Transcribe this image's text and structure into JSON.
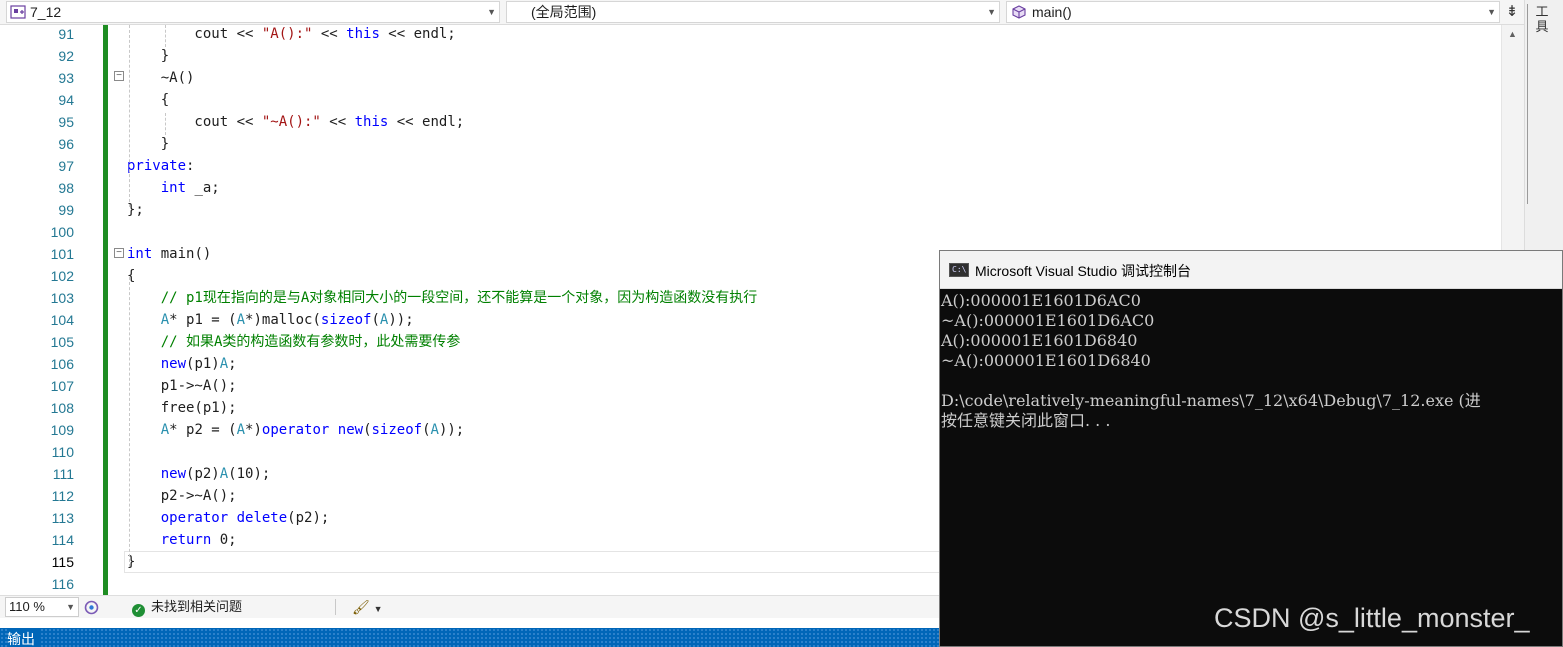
{
  "nav": {
    "project": "7_12",
    "scope": "(全局范围)",
    "function": "main()"
  },
  "side": {
    "toolbox_tab": "工具"
  },
  "editor": {
    "lines": [
      {
        "num": "91",
        "tokens": [
          [
            "",
            "        cout << "
          ],
          [
            "str",
            "\"A():\""
          ],
          [
            "",
            " << "
          ],
          [
            "kw",
            "this"
          ],
          [
            "",
            " << endl;"
          ]
        ]
      },
      {
        "num": "92",
        "tokens": [
          [
            "",
            "    }"
          ]
        ]
      },
      {
        "num": "93",
        "tokens": [
          [
            "",
            "    ~A()"
          ]
        ]
      },
      {
        "num": "94",
        "tokens": [
          [
            "",
            "    {"
          ]
        ]
      },
      {
        "num": "95",
        "tokens": [
          [
            "",
            "        cout << "
          ],
          [
            "str",
            "\"~A():\""
          ],
          [
            "",
            " << "
          ],
          [
            "kw",
            "this"
          ],
          [
            "",
            " << endl;"
          ]
        ]
      },
      {
        "num": "96",
        "tokens": [
          [
            "",
            "    }"
          ]
        ]
      },
      {
        "num": "97",
        "tokens": [
          [
            "kw",
            "private"
          ],
          [
            "",
            ":"
          ]
        ]
      },
      {
        "num": "98",
        "tokens": [
          [
            "",
            "    "
          ],
          [
            "kw",
            "int"
          ],
          [
            "",
            " _a;"
          ]
        ]
      },
      {
        "num": "99",
        "tokens": [
          [
            "",
            "};"
          ]
        ]
      },
      {
        "num": "100",
        "tokens": []
      },
      {
        "num": "101",
        "tokens": [
          [
            "kw",
            "int"
          ],
          [
            "",
            " main()"
          ]
        ]
      },
      {
        "num": "102",
        "tokens": [
          [
            "",
            "{"
          ]
        ]
      },
      {
        "num": "103",
        "tokens": [
          [
            "cm",
            "    // p1现在指向的是与A对象相同大小的一段空间，还不能算是一个对象，因为构造函数没有执行"
          ]
        ]
      },
      {
        "num": "104",
        "tokens": [
          [
            "",
            "    "
          ],
          [
            "ty",
            "A"
          ],
          [
            "",
            "* p1 = ("
          ],
          [
            "ty",
            "A"
          ],
          [
            "",
            "*)malloc("
          ],
          [
            "kw",
            "sizeof"
          ],
          [
            "",
            "("
          ],
          [
            "ty",
            "A"
          ],
          [
            "",
            "));"
          ]
        ]
      },
      {
        "num": "105",
        "tokens": [
          [
            "cm",
            "    // 如果A类的构造函数有参数时，此处需要传参"
          ]
        ]
      },
      {
        "num": "106",
        "tokens": [
          [
            "",
            "    "
          ],
          [
            "kw",
            "new"
          ],
          [
            "",
            "(p1)"
          ],
          [
            "ty",
            "A"
          ],
          [
            "",
            ";"
          ]
        ]
      },
      {
        "num": "107",
        "tokens": [
          [
            "",
            "    p1->~A();"
          ]
        ]
      },
      {
        "num": "108",
        "tokens": [
          [
            "",
            "    free(p1);"
          ]
        ]
      },
      {
        "num": "109",
        "tokens": [
          [
            "",
            "    "
          ],
          [
            "ty",
            "A"
          ],
          [
            "",
            "* p2 = ("
          ],
          [
            "ty",
            "A"
          ],
          [
            "",
            "*)"
          ],
          [
            "kw",
            "operator"
          ],
          [
            "",
            " "
          ],
          [
            "kw",
            "new"
          ],
          [
            "",
            "("
          ],
          [
            "kw",
            "sizeof"
          ],
          [
            "",
            "("
          ],
          [
            "ty",
            "A"
          ],
          [
            "",
            "));"
          ]
        ]
      },
      {
        "num": "110",
        "tokens": []
      },
      {
        "num": "111",
        "tokens": [
          [
            "",
            "    "
          ],
          [
            "kw",
            "new"
          ],
          [
            "",
            "(p2)"
          ],
          [
            "ty",
            "A"
          ],
          [
            "",
            "(10);"
          ]
        ]
      },
      {
        "num": "112",
        "tokens": [
          [
            "",
            "    p2->~A();"
          ]
        ]
      },
      {
        "num": "113",
        "tokens": [
          [
            "",
            "    "
          ],
          [
            "kw",
            "operator"
          ],
          [
            "",
            " "
          ],
          [
            "kw",
            "delete"
          ],
          [
            "",
            "(p2);"
          ]
        ]
      },
      {
        "num": "114",
        "tokens": [
          [
            "",
            "    "
          ],
          [
            "kw",
            "return"
          ],
          [
            "",
            " 0;"
          ]
        ]
      },
      {
        "num": "115",
        "tokens": [
          [
            "",
            "}"
          ]
        ]
      },
      {
        "num": "116",
        "tokens": []
      }
    ],
    "current_line": "115"
  },
  "status": {
    "zoom": "110 %",
    "issues": "未找到相关问题"
  },
  "output_panel": {
    "label": "输出"
  },
  "console": {
    "title": "Microsoft Visual Studio 调试控制台",
    "icon_text": "C:\\",
    "lines": [
      "A():000001E1601D6AC0",
      "~A():000001E1601D6AC0",
      "A():000001E1601D6840",
      "~A():000001E1601D6840",
      "",
      "D:\\code\\relatively-meaningful-names\\7_12\\x64\\Debug\\7_12.exe (进",
      "按任意键关闭此窗口. . ."
    ]
  },
  "watermark": "CSDN @s_little_monster_",
  "colors": {
    "keyword": "#0000ff",
    "comment": "#008000",
    "string": "#a31515",
    "type": "#2b91af",
    "line_number": "#237893",
    "change_bar": "#1e8d22",
    "output_bar": "#0066b8"
  },
  "icons": {
    "project": "project-icon",
    "function": "cube-icon",
    "split": "split-window-icon",
    "status_ok": "check-circle-icon",
    "cleanup": "brush-icon",
    "copilot": "copilot-icon"
  }
}
